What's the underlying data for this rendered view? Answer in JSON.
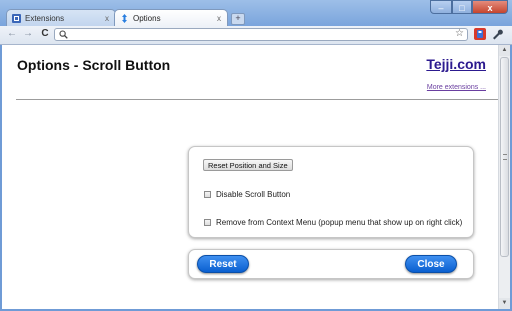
{
  "browser": {
    "tabs": [
      {
        "label": "Extensions",
        "active": false
      },
      {
        "label": "Options",
        "active": true
      }
    ],
    "new_tab_symbol": "+",
    "window_controls": {
      "minimize": "–",
      "maximize": "□",
      "close": "x"
    },
    "nav": {
      "back": "←",
      "forward": "→",
      "reload": "C"
    },
    "omnibox": {
      "value": "",
      "search_icon": "search-icon",
      "star_icon": "star-icon"
    },
    "extensions": [
      "scroll-button-extension-icon",
      "wrench-icon"
    ]
  },
  "page": {
    "title": "Options - Scroll Button",
    "brand_link": "Tejji.com",
    "more_link": "More extensions ...",
    "reset_position_label": "Reset Position and Size",
    "options": [
      {
        "label": "Disable Scroll Button",
        "checked": false
      },
      {
        "label": "Remove from Context Menu (popup menu that show up on right click)",
        "checked": false
      }
    ],
    "reset_label": "Reset",
    "close_label": "Close"
  },
  "colors": {
    "accent_button": "#0a5fd0",
    "brand_link": "#2c1a8f",
    "more_link": "#6a3fa0",
    "window_frame": "#6f9bd6"
  }
}
